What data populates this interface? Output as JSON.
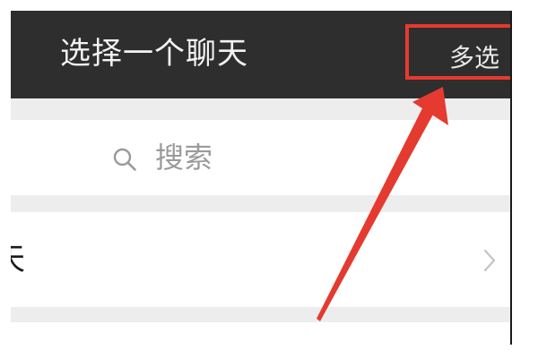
{
  "header": {
    "title": "选择一个聊天",
    "multi_select_label": "多选"
  },
  "search": {
    "placeholder": "搜索",
    "icon": "search-icon"
  },
  "list": {
    "item_label": "天",
    "chevron_icon": "chevron-right-icon"
  },
  "annotation": {
    "color": "#e53a30"
  },
  "colors": {
    "header_bg": "#2e2e2e",
    "page_bg": "#ededed"
  }
}
